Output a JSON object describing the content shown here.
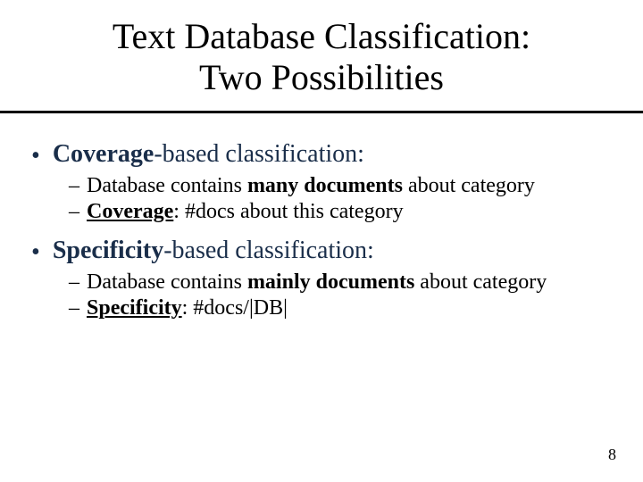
{
  "title_line1": "Text Database Classification:",
  "title_line2": "Two Possibilities",
  "bullets": [
    {
      "lead_strong": "Coverage",
      "rest": "-based classification:",
      "subs": [
        {
          "pre": "Database contains ",
          "strong": "many documents",
          "post": " about category"
        },
        {
          "pre": "",
          "strong_underline": "Coverage",
          "post": ": #docs about this category"
        }
      ]
    },
    {
      "lead_strong": "Specificity",
      "rest": "-based classification:",
      "subs": [
        {
          "pre": "Database contains ",
          "strong": "mainly documents",
          "post": " about category"
        },
        {
          "pre": "",
          "strong_underline": "Specificity",
          "post": ": #docs/|DB|"
        }
      ]
    }
  ],
  "page_number": "8"
}
